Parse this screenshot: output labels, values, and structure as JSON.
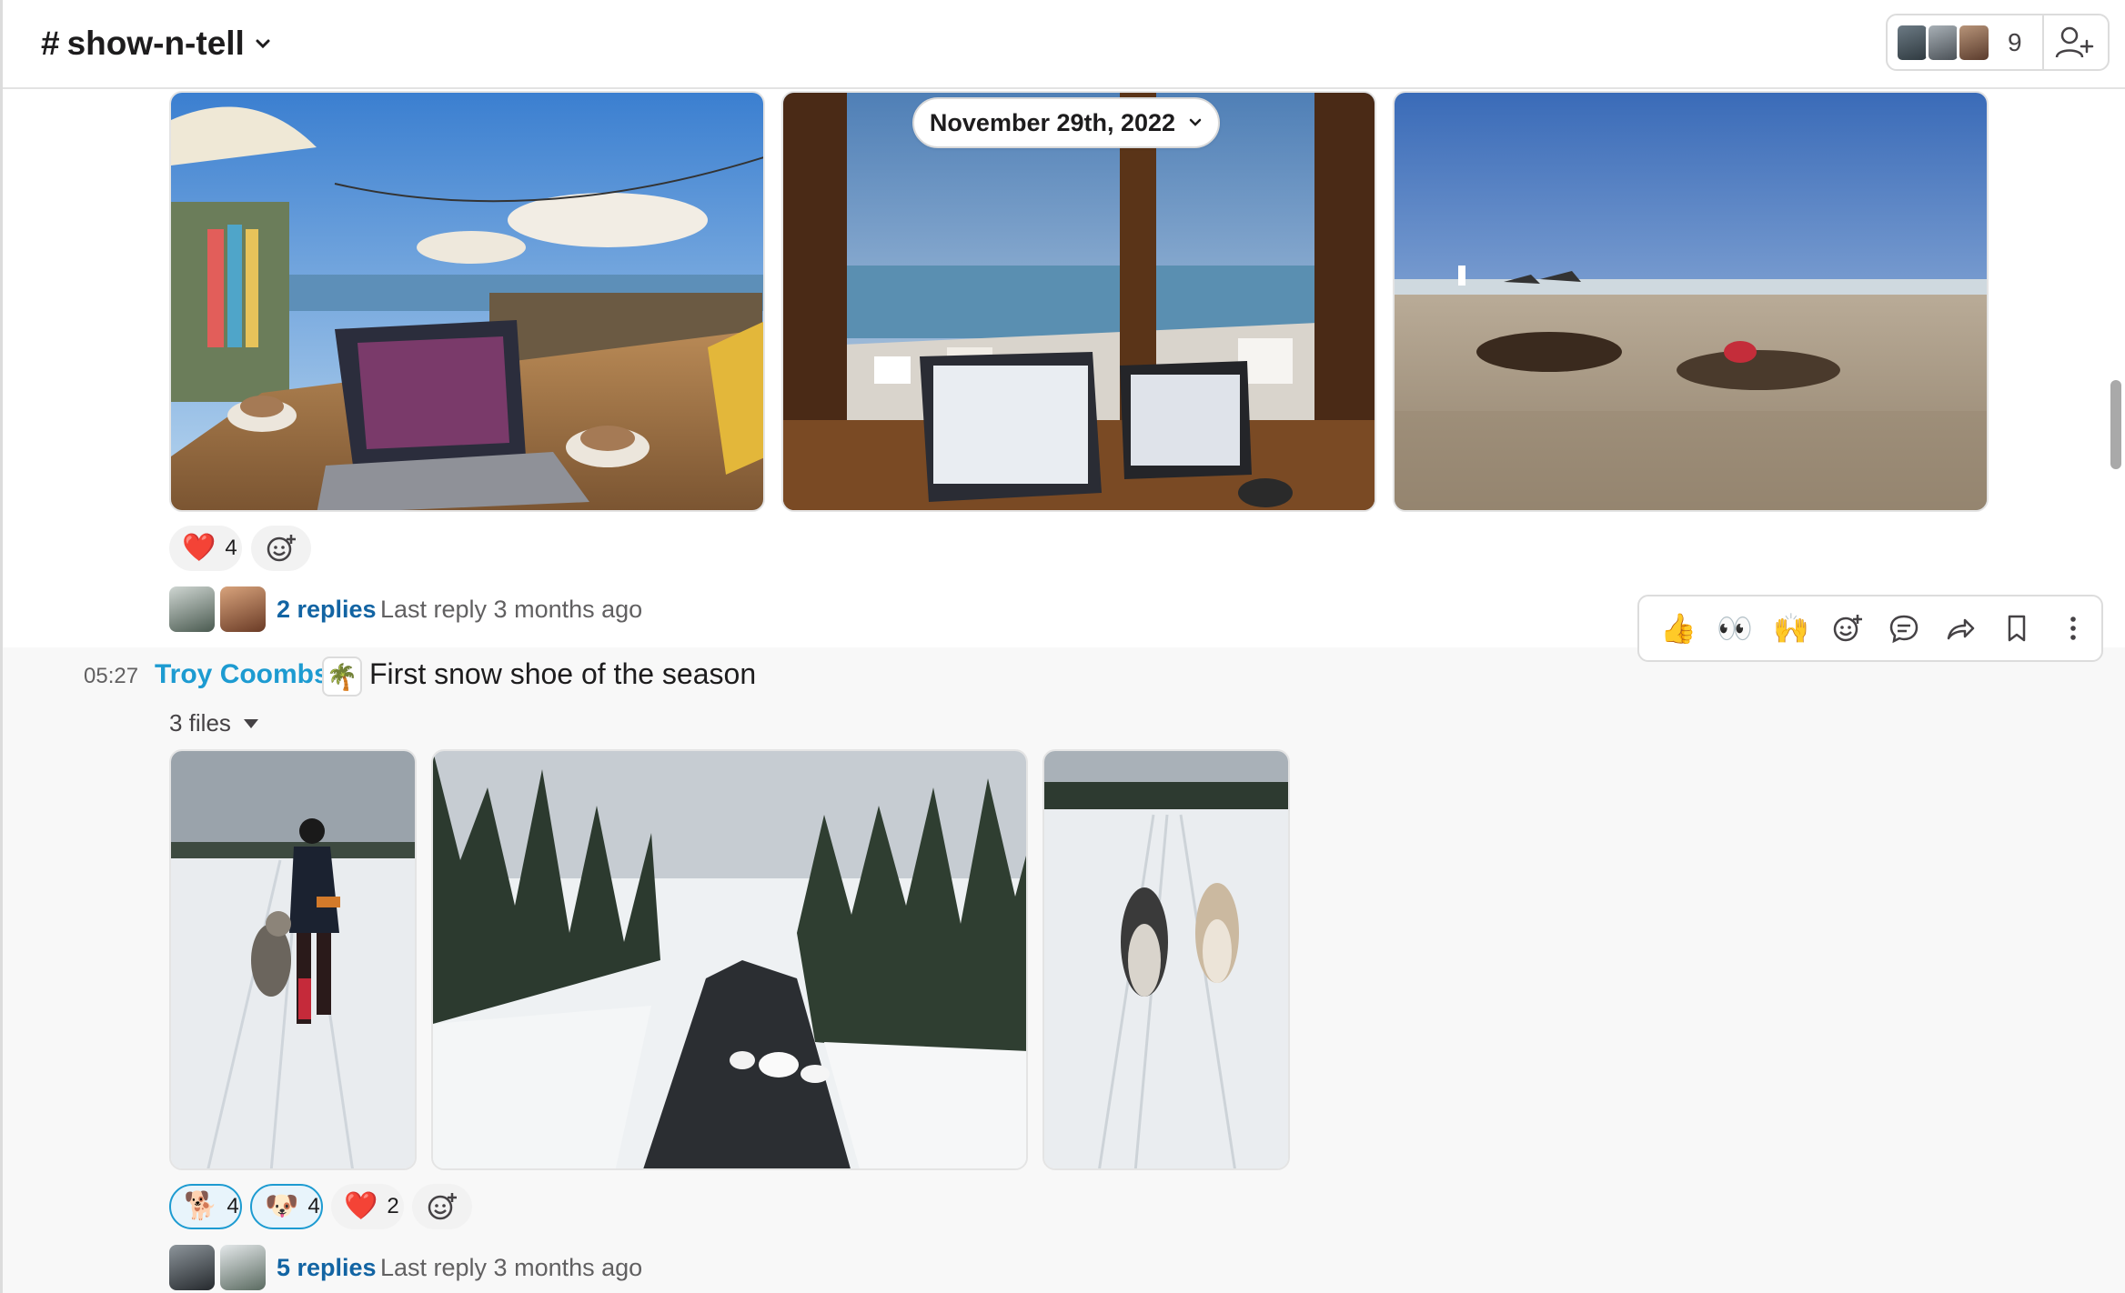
{
  "header": {
    "channel_hash": "#",
    "channel_name": "show-n-tell",
    "member_count": "9"
  },
  "date_divider": {
    "label": "November 29th, 2022"
  },
  "first_message": {
    "reactions": [
      {
        "emoji": "❤️",
        "count": "4"
      }
    ],
    "thread": {
      "replies": "2 replies",
      "last_reply": "Last reply 3 months ago"
    }
  },
  "second_message": {
    "timestamp": "05:27",
    "author": "Troy Coombs",
    "status_emoji": "🌴",
    "text": "First snow shoe of the season",
    "files_label": "3 files",
    "reactions": [
      {
        "emoji": "🐕",
        "count": "4"
      },
      {
        "emoji": "🐶",
        "count": "4"
      },
      {
        "emoji": "❤️",
        "count": "2"
      }
    ],
    "thread": {
      "replies": "5 replies",
      "last_reply": "Last reply 3 months ago"
    }
  },
  "toolbar": {
    "emoji_thumbs": "👍",
    "emoji_eyes": "👀",
    "emoji_hands": "🙌"
  },
  "colors": {
    "link": "#1264a3",
    "author": "#1d9bd1",
    "accent_border": "#1d9bd1"
  }
}
